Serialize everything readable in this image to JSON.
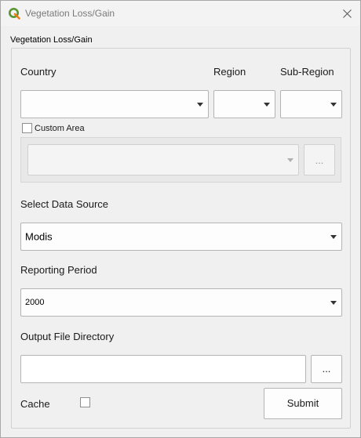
{
  "window": {
    "title": "Vegetation Loss/Gain"
  },
  "group": {
    "title": "Vegetation Loss/Gain"
  },
  "country": {
    "label": "Country",
    "value": ""
  },
  "region": {
    "label": "Region",
    "value": ""
  },
  "sub_region": {
    "label": "Sub-Region",
    "value": ""
  },
  "custom_area": {
    "label": "Custom Area",
    "checked": false,
    "value": "",
    "browse_label": "..."
  },
  "data_source": {
    "label": "Select Data Source",
    "value": "Modis"
  },
  "reporting_period": {
    "label": "Reporting Period",
    "value": "2000"
  },
  "output_dir": {
    "label": "Output File Directory",
    "value": "",
    "browse_label": "..."
  },
  "cache": {
    "label": "Cache",
    "checked": false
  },
  "submit": {
    "label": "Submit"
  },
  "colors": {
    "qgis_green": "#589632",
    "qgis_yellow": "#ee7913"
  },
  "icons": {
    "app": "qgis-logo-icon",
    "close": "close-icon",
    "dropdown": "chevron-down-icon"
  }
}
